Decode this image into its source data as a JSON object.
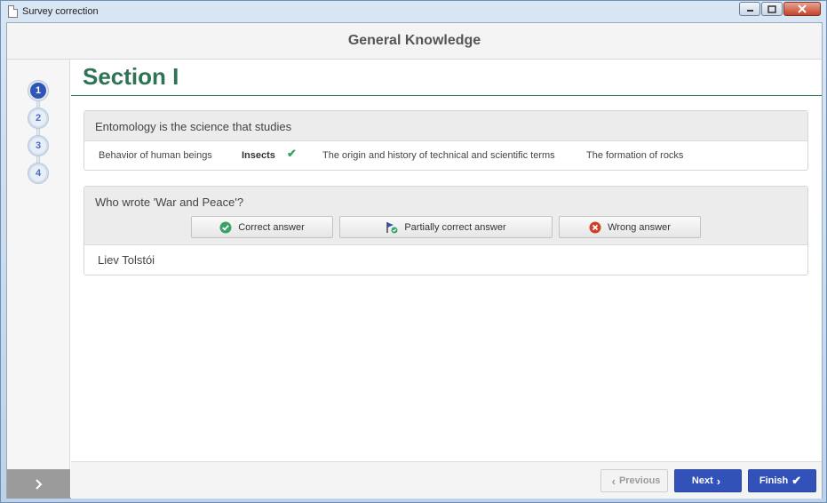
{
  "window": {
    "title": "Survey correction",
    "controls": [
      "minimize",
      "maximize",
      "close"
    ]
  },
  "header": {
    "title": "General Knowledge"
  },
  "sidebar": {
    "steps": [
      {
        "label": "1",
        "active": true
      },
      {
        "label": "2",
        "active": false
      },
      {
        "label": "3",
        "active": false
      },
      {
        "label": "4",
        "active": false
      }
    ],
    "toggle_icon": "chevron-right-icon"
  },
  "section": {
    "title": "Section I"
  },
  "questions": [
    {
      "text": "Entomology is the science that studies",
      "options": [
        "Behavior of human beings",
        "Insects",
        "The origin and history of technical and scientific terms",
        "The formation of rocks"
      ],
      "selected_option": "Insects",
      "selected_icon": "check-icon"
    },
    {
      "text": "Who wrote 'War and Peace'?",
      "grading": {
        "correct": "Correct answer",
        "partial": "Partially correct answer",
        "wrong": "Wrong answer"
      },
      "answer": "Liev Tolstói"
    }
  ],
  "footer": {
    "previous": "Previous",
    "next": "Next",
    "finish": "Finish"
  },
  "colors": {
    "accent": "#3352b9",
    "section_title": "#2e7353",
    "correct": "#3aa266",
    "wrong": "#d0402a",
    "titlebar": "#d9e6f4"
  }
}
